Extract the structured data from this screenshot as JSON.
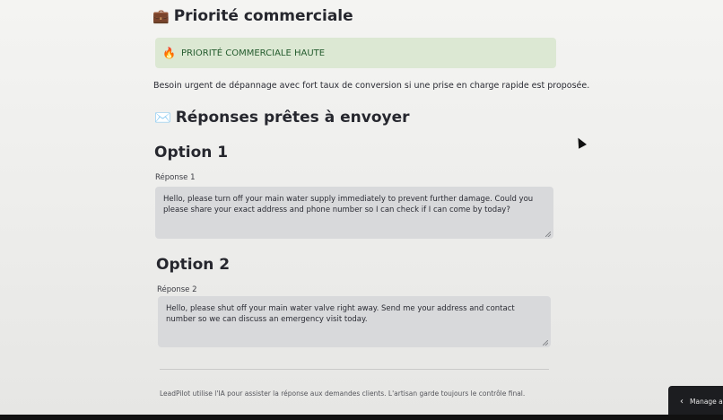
{
  "sections": {
    "commercial_heading": {
      "emoji": "💼",
      "title": "Priorité commerciale"
    },
    "responses_heading": {
      "emoji": "✉️",
      "title": "Réponses prêtes à envoyer"
    }
  },
  "alert": {
    "emoji": "🔥",
    "text": "PRIORITÉ COMMERCIALE HAUTE",
    "background": "#dce8d3",
    "text_color": "#245c2e"
  },
  "description": "Besoin urgent de dépannage avec fort taux de conversion si une prise en charge rapide est proposée.",
  "options": [
    {
      "title": "Option 1",
      "label": "Réponse 1",
      "value": "Hello, please turn off your main water supply immediately to prevent further damage. Could you please share your exact address and phone number so I can check if I can come by today?"
    },
    {
      "title": "Option 2",
      "label": "Réponse 2",
      "value": "Hello, please shut off your main water valve right away. Send me your address and contact number so we can discuss an emergency visit today."
    }
  ],
  "footer": "LeadPilot utilise l'IA pour assister la réponse aux demandes clients. L'artisan garde toujours le contrôle final.",
  "manage_tab": {
    "icon": "chevron-left-icon",
    "label": "Manage a"
  }
}
